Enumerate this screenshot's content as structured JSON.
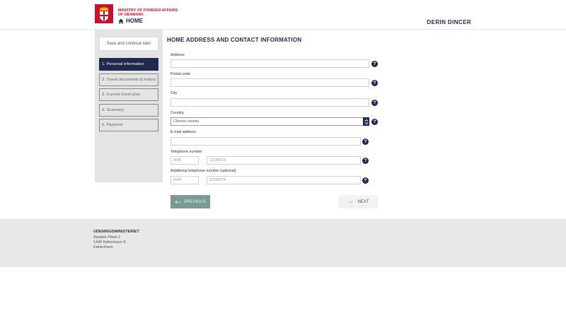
{
  "header": {
    "ministry_line1": "MINISTRY OF FOREIGN AFFAIRS",
    "ministry_line2": "OF DENMARK",
    "home_label": "HOME",
    "user_name": "DERIN DINCER",
    "brand_color": "#c8102e",
    "navy_color": "#1d2a4e"
  },
  "sidebar": {
    "save_label": "Save and continue later",
    "steps": [
      {
        "label": "1. Personal information",
        "active": true
      },
      {
        "label": "2. Travel documents & history",
        "active": false
      },
      {
        "label": "3. Current travel plan",
        "active": false
      },
      {
        "label": "4. Summary",
        "active": false
      },
      {
        "label": "5. Payment",
        "active": false
      }
    ]
  },
  "form": {
    "title": "HOME ADDRESS AND CONTACT INFORMATION",
    "address": {
      "label": "Address",
      "value": ""
    },
    "postal_code": {
      "label": "Postal code",
      "value": ""
    },
    "city": {
      "label": "City",
      "value": ""
    },
    "country": {
      "label": "Country",
      "selected": "Choose country"
    },
    "email": {
      "label": "E-mail address",
      "value": ""
    },
    "telephone": {
      "label": "Telephone number",
      "prefix_placeholder": "0045",
      "number_placeholder": "12345678"
    },
    "additional_telephone": {
      "label": "Additional telephone number (optional)",
      "prefix_placeholder": "0045",
      "number_placeholder": "12345678"
    },
    "help_glyph": "?"
  },
  "buttons": {
    "previous_label": "PREVIOUS",
    "next_label": "NEXT"
  },
  "footer": {
    "org": "UDENRIGSMINISTERIET",
    "line1": "Asiatisk Plads 2",
    "line2": "1448 København K",
    "line3": "København"
  }
}
